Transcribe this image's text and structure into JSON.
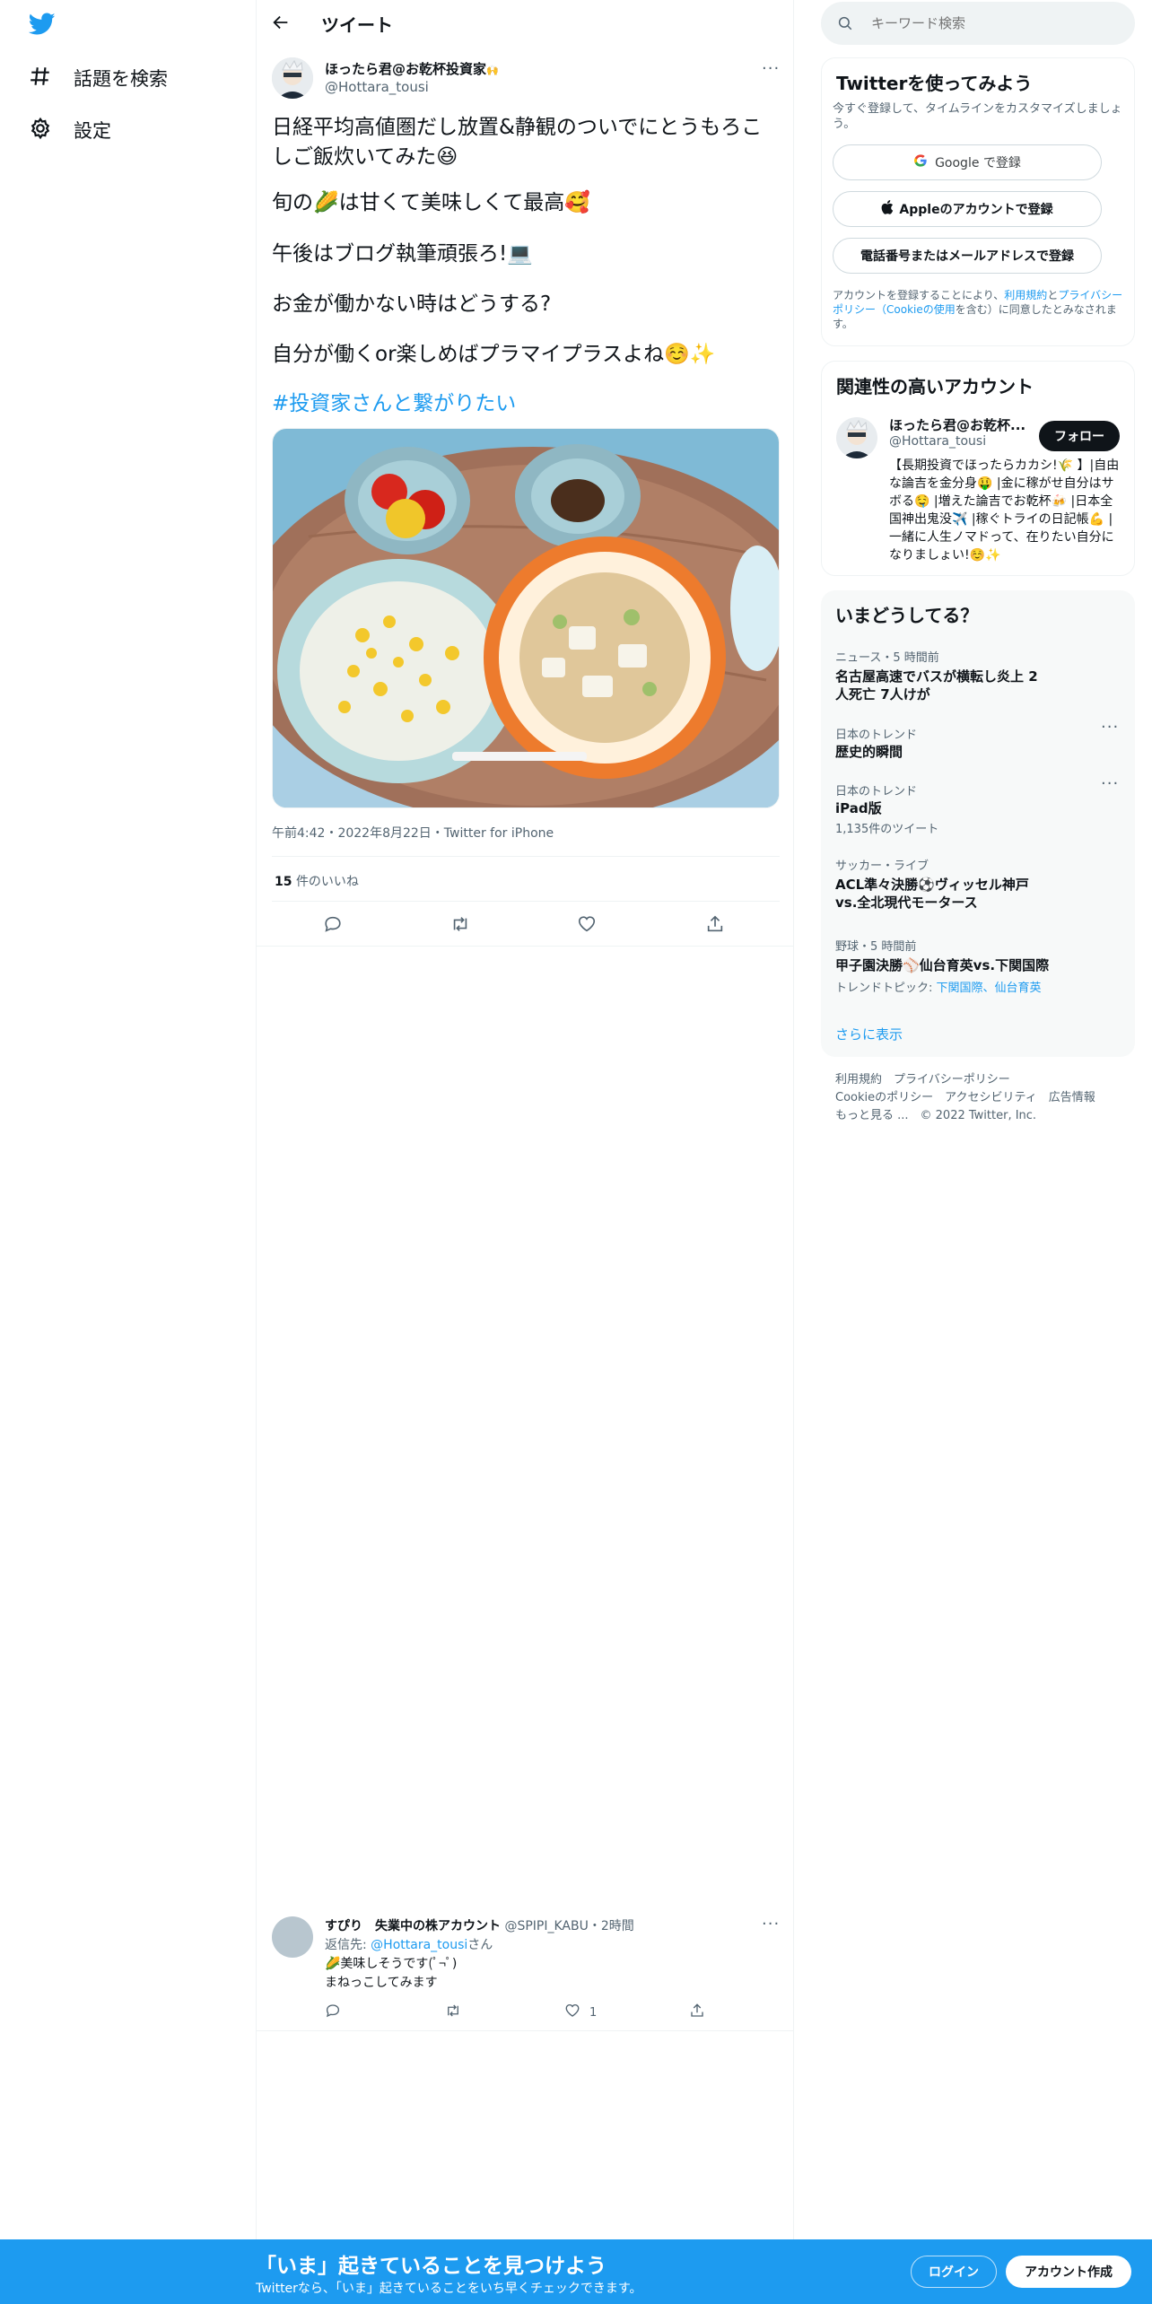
{
  "colors": {
    "accent": "#1d9bf0",
    "text": "#0f1419",
    "muted": "#536471",
    "banner": "#1d9bf0"
  },
  "nav": {
    "logo_icon": "twitter-bird-icon",
    "items": [
      {
        "label": "話題を検索",
        "icon": "hash-icon"
      },
      {
        "label": "設定",
        "icon": "gear-icon"
      }
    ]
  },
  "header": {
    "title": "ツイート"
  },
  "tweet": {
    "author_name": "ほったら君@お乾杯投資家",
    "author_emoji": "🙌",
    "author_handle": "@Hottara_tousi",
    "lines": [
      "日経平均高値圏だし放置&静観のついでにとうもろこしご飯炊いてみた😆",
      "旬の🌽は甘くて美味しくて最高🥰",
      "午後はブログ執筆頑張ろ!💻",
      "お金が働かない時はどうする?",
      "自分が働くor楽しめばプラマイプラスよね☺️✨"
    ],
    "hashtag": "#投資家さんと繋がりたい",
    "image_alt": "とうもろこしご飯の写真",
    "meta": "午前4:42・2022年8月22日・Twitter for iPhone",
    "likes_count": "15",
    "likes_label": "件のいいね"
  },
  "reply": {
    "name": "すぴり　失業中の株アカウント",
    "handle": "@SPIPI_KABU",
    "time": "・2時間",
    "reply_to_prefix": "返信先: ",
    "reply_to_handle": "@Hottara_tousi",
    "reply_to_suffix": "さん",
    "line1": "🌽美味しそうです(ﾟ¬ﾟ)",
    "line2": "まねっこしてみます",
    "like_count": "1"
  },
  "search": {
    "placeholder": "キーワード検索"
  },
  "signup": {
    "title": "Twitterを使ってみよう",
    "subtitle": "今すぐ登録して、タイムラインをカスタマイズしましょう。",
    "google": "Google で登録",
    "apple": "Appleのアカウントで登録",
    "phone": "電話番号またはメールアドレスで登録",
    "legal_prefix": "アカウントを登録することにより、",
    "legal_terms": "利用規約",
    "legal_and": "と",
    "legal_privacy": "プライバシーポリシー（Cookieの使用",
    "legal_suffix": "を含む）に同意したとみなされます。"
  },
  "related": {
    "title": "関連性の高いアカウント",
    "name": "ほったら君@お乾杯...",
    "handle": "@Hottara_tousi",
    "follow": "フォロー",
    "bio": "【長期投資でほったらカカシ!🌾 】|自由な論吉を金分身🤑 |金に稼がせ自分はサボる🤤 |増えた論吉でお乾杯🍻 |日本全国神出鬼没✈️ |稼ぐトライの日記帳💪 |一緒に人生ノマドって、在りたい自分になりましょい!☺️✨"
  },
  "trends": {
    "title": "いまどうしてる？",
    "items": [
      {
        "context": "ニュース・5 時間前",
        "title": "名古屋高速でバスが横転し炎上 2人死亡 7人けが",
        "extra": ""
      },
      {
        "context": "日本のトレンド",
        "title": "歴史的瞬間",
        "extra": ""
      },
      {
        "context": "日本のトレンド",
        "title": "iPad版",
        "extra": "1,135件のツイート"
      },
      {
        "context": "サッカー・ライブ",
        "title": "ACL準々決勝⚽ヴィッセル神戸vs.全北現代モータース",
        "extra": ""
      },
      {
        "context": "野球・5 時間前",
        "title": "甲子園決勝⚾仙台育英vs.下関国際",
        "extra": ""
      }
    ],
    "topic_prefix": "トレンドトピック: ",
    "topic_links": "下関国際、仙台育英",
    "more": "さらに表示"
  },
  "footer": {
    "line1": "利用規約　プライバシーポリシー",
    "line2": "Cookieのポリシー　アクセシビリティ　広告情報",
    "line3": "もっと見る ...　© 2022 Twitter, Inc."
  },
  "banner": {
    "title": "「いま」起きていることを見つけよう",
    "subtitle": "Twitterなら、「いま」起きていることをいち早くチェックできます。",
    "login": "ログイン",
    "signup": "アカウント作成"
  }
}
